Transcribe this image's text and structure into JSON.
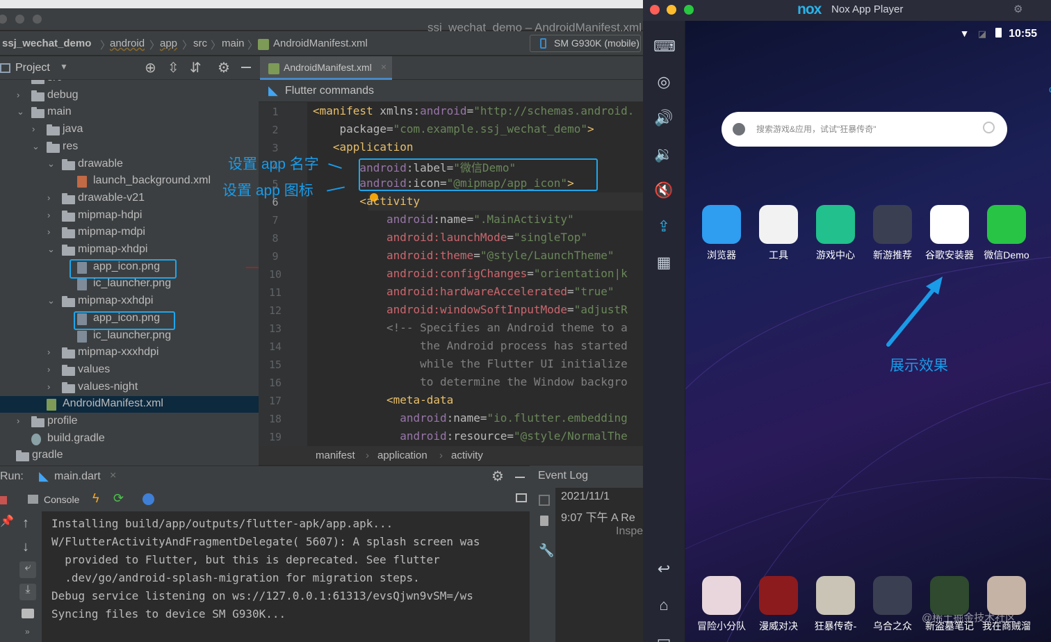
{
  "ide": {
    "window_title": "ssj_wechat_demo – AndroidManifest.xml",
    "breadcrumbs": [
      "ssj_wechat_demo",
      "android",
      "app",
      "src",
      "main",
      "AndroidManifest.xml"
    ],
    "device": "SM G930K (mobile)",
    "project_label": "Project",
    "tab": "AndroidManifest.xml",
    "flutter_commands": "Flutter commands",
    "tree": [
      {
        "label": "src",
        "arrow": "",
        "indent": 1,
        "kind": "folder"
      },
      {
        "label": "debug",
        "arrow": "›",
        "indent": 1,
        "kind": "folder"
      },
      {
        "label": "main",
        "arrow": "⌄",
        "indent": 1,
        "kind": "folder"
      },
      {
        "label": "java",
        "arrow": "›",
        "indent": 2,
        "kind": "folder"
      },
      {
        "label": "res",
        "arrow": "⌄",
        "indent": 2,
        "kind": "folder"
      },
      {
        "label": "drawable",
        "arrow": "⌄",
        "indent": 3,
        "kind": "folder"
      },
      {
        "label": "launch_background.xml",
        "arrow": "",
        "indent": 4,
        "kind": "file"
      },
      {
        "label": "drawable-v21",
        "arrow": "›",
        "indent": 3,
        "kind": "folder"
      },
      {
        "label": "mipmap-hdpi",
        "arrow": "›",
        "indent": 3,
        "kind": "folder"
      },
      {
        "label": "mipmap-mdpi",
        "arrow": "›",
        "indent": 3,
        "kind": "folder"
      },
      {
        "label": "mipmap-xhdpi",
        "arrow": "⌄",
        "indent": 3,
        "kind": "folder"
      },
      {
        "label": "app_icon.png",
        "arrow": "",
        "indent": 4,
        "kind": "file"
      },
      {
        "label": "ic_launcher.png",
        "arrow": "",
        "indent": 4,
        "kind": "file"
      },
      {
        "label": "mipmap-xxhdpi",
        "arrow": "⌄",
        "indent": 3,
        "kind": "folder"
      },
      {
        "label": "app_icon.png",
        "arrow": "",
        "indent": 4,
        "kind": "file"
      },
      {
        "label": "ic_launcher.png",
        "arrow": "",
        "indent": 4,
        "kind": "file"
      },
      {
        "label": "mipmap-xxxhdpi",
        "arrow": "›",
        "indent": 3,
        "kind": "folder"
      },
      {
        "label": "values",
        "arrow": "›",
        "indent": 3,
        "kind": "folder"
      },
      {
        "label": "values-night",
        "arrow": "›",
        "indent": 3,
        "kind": "folder"
      },
      {
        "label": "AndroidManifest.xml",
        "arrow": "",
        "indent": 2,
        "kind": "manifest",
        "selected": true
      },
      {
        "label": "profile",
        "arrow": "›",
        "indent": 1,
        "kind": "folder"
      },
      {
        "label": "build.gradle",
        "arrow": "",
        "indent": 1,
        "kind": "gradle"
      },
      {
        "label": "gradle",
        "arrow": "",
        "indent": 0,
        "kind": "folder"
      }
    ],
    "line_numbers": [
      "1",
      "2",
      "3",
      "4",
      "5",
      "6",
      "7",
      "8",
      "9",
      "10",
      "11",
      "12",
      "13",
      "14",
      "15",
      "16",
      "17",
      "18",
      "19"
    ],
    "code_lines": [
      [
        {
          "t": "<manifest ",
          "c": "tag"
        },
        {
          "t": "xmlns:",
          "c": "attr"
        },
        {
          "t": "android",
          "c": "ns"
        },
        {
          "t": "=",
          "c": "attr"
        },
        {
          "t": "\"http://schemas.android.",
          "c": "val"
        }
      ],
      [
        {
          "t": "    package",
          "c": "attr"
        },
        {
          "t": "=",
          "c": "attr"
        },
        {
          "t": "\"com.example.ssj_wechat_demo\"",
          "c": "val"
        },
        {
          "t": ">",
          "c": "tag"
        }
      ],
      [
        {
          "t": "   <application",
          "c": "tag"
        }
      ],
      [
        {
          "t": "       android",
          "c": "ns"
        },
        {
          "t": ":label",
          "c": "attr"
        },
        {
          "t": "=",
          "c": "attr"
        },
        {
          "t": "\"微信Demo\"",
          "c": "val"
        }
      ],
      [
        {
          "t": "       android",
          "c": "ns"
        },
        {
          "t": ":icon",
          "c": "attr"
        },
        {
          "t": "=",
          "c": "attr"
        },
        {
          "t": "\"@mipmap/app_icon\"",
          "c": "val"
        },
        {
          "t": ">",
          "c": "tag"
        }
      ],
      [
        {
          "t": "       <activity",
          "c": "tag"
        }
      ],
      [
        {
          "t": "           android",
          "c": "ns"
        },
        {
          "t": ":name",
          "c": "attr"
        },
        {
          "t": "=",
          "c": "attr"
        },
        {
          "t": "\".MainActivity\"",
          "c": "val"
        }
      ],
      [
        {
          "t": "           android:launchMode",
          "c": "red"
        },
        {
          "t": "=",
          "c": "attr"
        },
        {
          "t": "\"singleTop\"",
          "c": "val"
        }
      ],
      [
        {
          "t": "           android:theme",
          "c": "red"
        },
        {
          "t": "=",
          "c": "attr"
        },
        {
          "t": "\"@style/LaunchTheme\"",
          "c": "val"
        }
      ],
      [
        {
          "t": "           android:configChanges",
          "c": "red"
        },
        {
          "t": "=",
          "c": "attr"
        },
        {
          "t": "\"orientation|k",
          "c": "val"
        }
      ],
      [
        {
          "t": "           android:hardwareAccelerated",
          "c": "red"
        },
        {
          "t": "=",
          "c": "attr"
        },
        {
          "t": "\"true\"",
          "c": "val"
        }
      ],
      [
        {
          "t": "           android:windowSoftInputMode",
          "c": "red"
        },
        {
          "t": "=",
          "c": "attr"
        },
        {
          "t": "\"adjustR",
          "c": "val"
        }
      ],
      [
        {
          "t": "           <!-- Specifies an Android theme to a",
          "c": "cmt"
        }
      ],
      [
        {
          "t": "                the Android process has started",
          "c": "cmt"
        }
      ],
      [
        {
          "t": "                while the Flutter UI initialize",
          "c": "cmt"
        }
      ],
      [
        {
          "t": "                to determine the Window backgro",
          "c": "cmt"
        }
      ],
      [
        {
          "t": "           <meta-data",
          "c": "tag"
        }
      ],
      [
        {
          "t": "             android",
          "c": "ns"
        },
        {
          "t": ":name",
          "c": "attr"
        },
        {
          "t": "=",
          "c": "attr"
        },
        {
          "t": "\"io.flutter.embedding",
          "c": "val"
        }
      ],
      [
        {
          "t": "             android",
          "c": "ns"
        },
        {
          "t": ":resource",
          "c": "attr"
        },
        {
          "t": "=",
          "c": "attr"
        },
        {
          "t": "\"@style/NormalThe",
          "c": "val"
        }
      ]
    ],
    "editor_breadcrumb": [
      "manifest",
      "application",
      "activity"
    ],
    "annotations": {
      "name": "设置 app 名字",
      "icon": "设置 app 图标"
    },
    "run": {
      "label": "Run:",
      "tab": "main.dart",
      "console_tab": "Console",
      "console_lines": [
        "Installing build/app/outputs/flutter-apk/app.apk...",
        "W/FlutterActivityAndFragmentDelegate( 5607): A splash screen was",
        "  provided to Flutter, but this is deprecated. See flutter",
        "  .dev/go/android-splash-migration for migration steps.",
        "Debug service listening on ws://127.0.0.1:61313/evsQjwn9vSM=/ws",
        "Syncing files to device SM G930K..."
      ]
    },
    "event_log": {
      "title": "Event Log",
      "date": "2021/11/1",
      "time": "9:07 下午  A Re",
      "more": "Inspe"
    }
  },
  "nox": {
    "brand": "nox",
    "title": "Nox App Player",
    "clock": "10:55",
    "search_placeholder": "搜索游戏&应用，试试\"狂暴传奇\"",
    "apps_row1": [
      {
        "name": "浏览器",
        "color": "#2f9df0"
      },
      {
        "name": "工具",
        "color": "#f2f2f2"
      },
      {
        "name": "游戏中心",
        "color": "#22c08c"
      },
      {
        "name": "新游推荐",
        "color": "#3b3f52"
      },
      {
        "name": "谷歌安装器",
        "color": "#ffffff"
      },
      {
        "name": "微信Demo",
        "color": "#28c445"
      }
    ],
    "show_effect": "展示效果",
    "apps_dock": [
      {
        "name": "冒险小分队",
        "color": "#e9d6dc"
      },
      {
        "name": "漫威对决",
        "color": "#8c1b1e"
      },
      {
        "name": "狂暴传奇-",
        "color": "#c9c4b6"
      },
      {
        "name": "乌合之众",
        "color": "#3b3f52"
      },
      {
        "name": "新盗墓笔记",
        "color": "#2f4a2e"
      },
      {
        "name": "我在商贼溜",
        "color": "#c5b3a6"
      }
    ],
    "watermark": "@稀土掘金技术社区"
  }
}
